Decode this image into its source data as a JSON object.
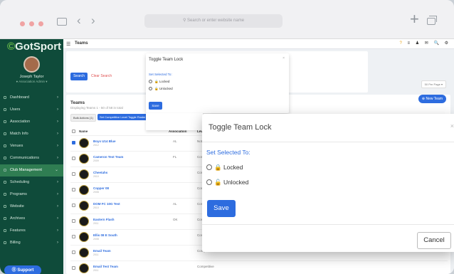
{
  "browser": {
    "url_placeholder": "Search or enter website name"
  },
  "app": {
    "logo": "GotSport",
    "page_title": "Teams",
    "user": {
      "name": "Joseph Taylor",
      "role": "● Association Admin ▾"
    },
    "sidebar": {
      "items": [
        {
          "label": "Dashboard"
        },
        {
          "label": "Users"
        },
        {
          "label": "Association"
        },
        {
          "label": "Match Info"
        },
        {
          "label": "Venues"
        },
        {
          "label": "Communications"
        },
        {
          "label": "Club Management"
        },
        {
          "label": "Scheduling"
        },
        {
          "label": "Programs"
        },
        {
          "label": "Website"
        },
        {
          "label": "Archives"
        },
        {
          "label": "Features"
        },
        {
          "label": "Billing"
        }
      ],
      "support": "⓪ Support"
    },
    "topbar_icons": [
      "?",
      "≡",
      "♟",
      "✉",
      "🔍",
      "⚙"
    ]
  },
  "filters": {
    "search": "Search",
    "clear": "Clear Search"
  },
  "teams": {
    "title": "Teams",
    "subtitle": "Displaying Teams 1 - 50 of 58 in total",
    "bulk_label": "Bulk Actions (1)",
    "bulk_action": "Set Competitive Level   Toggle Roster",
    "per_page": "50 Per Page ▾",
    "new_team": "⊕ New Team",
    "columns": {
      "name": "Name",
      "assoc": "Association",
      "level": "Level"
    },
    "rows": [
      {
        "name": "Boys U14 Blue",
        "sub": "2012",
        "state": "AL",
        "level": "Not Re",
        "checked": true
      },
      {
        "name": "Cameron Test Team",
        "sub": "2009",
        "state": "FL",
        "level": "Compe"
      },
      {
        "name": "Cheetahs",
        "sub": "2010",
        "state": "",
        "level": "Compe"
      },
      {
        "name": "Copper 08",
        "sub": "2008",
        "state": "",
        "level": "Compe"
      },
      {
        "name": "DOM FC 10G Test",
        "sub": "2010",
        "state": "AL",
        "level": "Compe"
      },
      {
        "name": "Eastern Flash",
        "sub": "2011",
        "state": "OK",
        "level": "Compe"
      },
      {
        "name": "Ellis 08 E South",
        "sub": "2008",
        "state": "",
        "level": "Compe"
      },
      {
        "name": "Email Team",
        "sub": "2011",
        "state": "",
        "level": "Competitive"
      },
      {
        "name": "Email Test Team",
        "sub": "2011",
        "state": "",
        "level": "Competitive"
      }
    ]
  },
  "modal_small": {
    "title": "Toggle Team Lock",
    "close": "×",
    "subtitle": "Set Selected To:",
    "option_locked": "🔒 Locked",
    "option_unlocked": "🔓 Unlocked",
    "save": "Save"
  },
  "modal": {
    "title": "Toggle Team Lock",
    "close": "×",
    "subtitle": "Set Selected To:",
    "option_locked": "🔒 Locked",
    "option_unlocked": "🔓 Unlocked",
    "save": "Save",
    "cancel": "Cancel"
  }
}
